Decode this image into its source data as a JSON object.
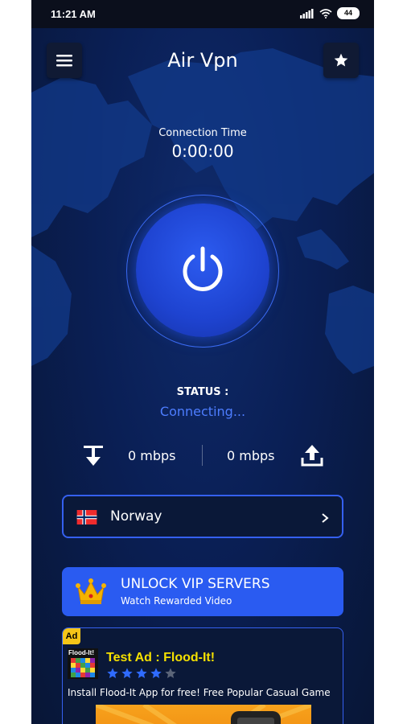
{
  "status_bar": {
    "time": "11:21 AM",
    "battery": "44"
  },
  "header": {
    "title": "Air Vpn",
    "menu_icon": "hamburger-menu-icon",
    "favorite_icon": "star-icon"
  },
  "connection": {
    "label": "Connection Time",
    "time": "0:00:00"
  },
  "status": {
    "label": "STATUS :",
    "value": "Connecting..."
  },
  "speeds": {
    "download": "0 mbps",
    "upload": "0 mbps"
  },
  "server": {
    "name": "Norway",
    "flag_icon": "norway-flag-icon"
  },
  "vip": {
    "title": "UNLOCK VIP SERVERS",
    "subtitle": "Watch Rewarded Video",
    "icon": "crown-icon"
  },
  "ad": {
    "badge": "Ad",
    "app_icon_label": "Flood-It!",
    "title": "Test Ad : Flood-It!",
    "rating": 4,
    "rating_max": 5,
    "description": "Install Flood-It App for free! Free Popular Casual Game"
  },
  "colors": {
    "accent": "#2a5bf1",
    "status_text": "#4d7dff",
    "background": "#0a1838",
    "ad_title": "#f5e000"
  }
}
